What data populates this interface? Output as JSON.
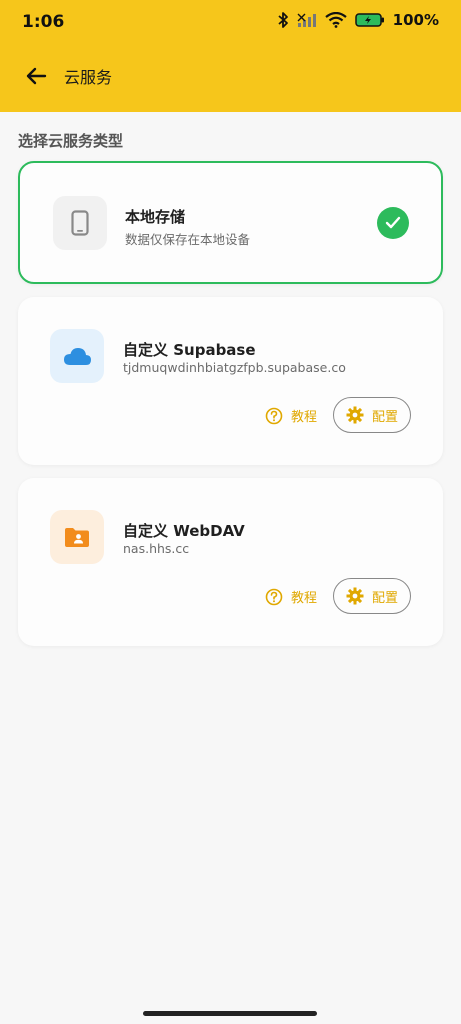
{
  "status_bar": {
    "time": "1:06",
    "battery": "100%"
  },
  "toolbar": {
    "title": "云服务"
  },
  "section_label": "选择云服务类型",
  "cards": [
    {
      "title": "本地存储",
      "subtitle": "数据仅保存在本地设备",
      "icon": "phone-icon",
      "selected": true
    },
    {
      "title": "自定义 Supabase",
      "subtitle": "tjdmuqwdinhbiatgzfpb.supabase.co",
      "icon": "cloud-icon",
      "tutorial_label": "教程",
      "config_label": "配置"
    },
    {
      "title": "自定义 WebDAV",
      "subtitle": "nas.hhs.cc",
      "icon": "folder-user-icon",
      "tutorial_label": "教程",
      "config_label": "配置"
    }
  ],
  "colors": {
    "header": "#f6c61b",
    "selected_border": "#2dbb5c",
    "accent": "#e0a800"
  }
}
